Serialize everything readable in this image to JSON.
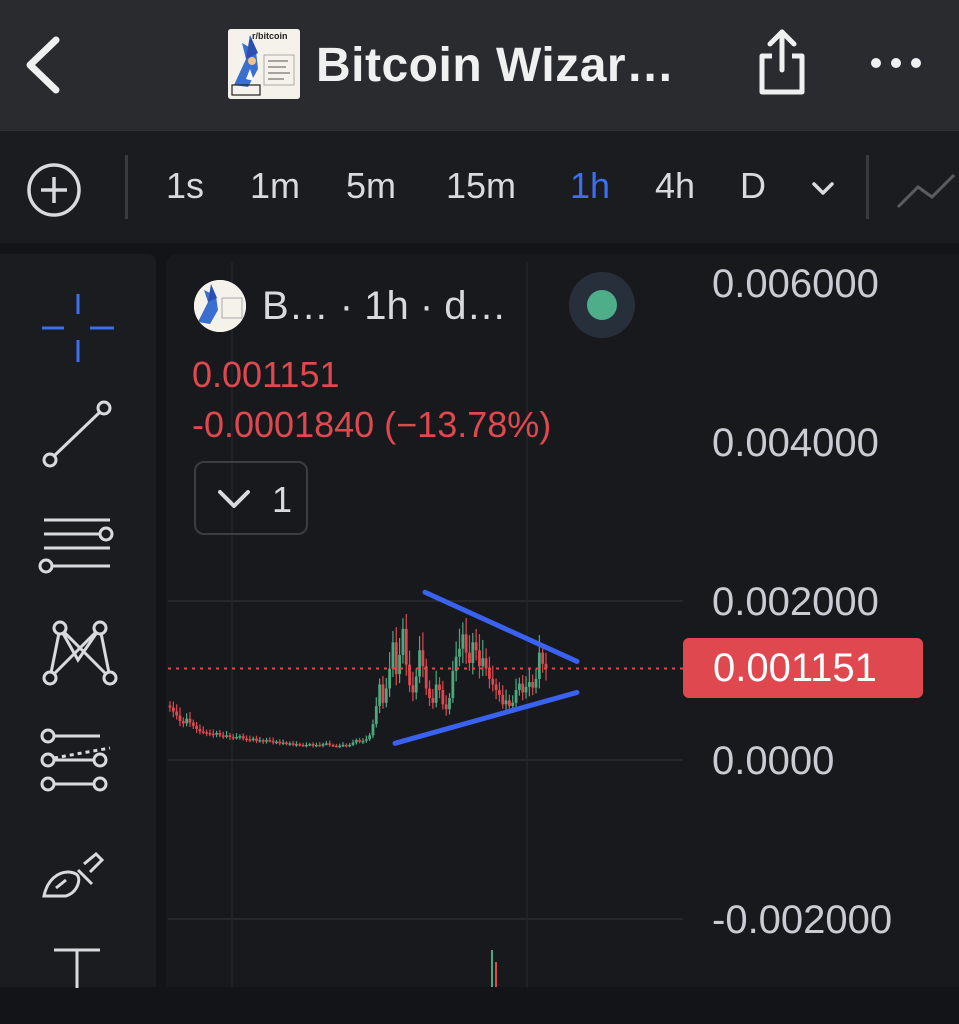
{
  "header": {
    "title": "Bitcoin Wizar…",
    "logo_text": "r/bitcoin",
    "back_icon": "chevron-left-icon",
    "share_icon": "share-icon",
    "more_icon": "ellipsis-icon"
  },
  "toolbar": {
    "add_icon": "plus-circle-icon",
    "timeframes": [
      "1s",
      "1m",
      "5m",
      "15m",
      "1h",
      "4h",
      "D"
    ],
    "active_timeframe": "1h",
    "expand_icon": "chevron-down-icon",
    "chart_type_icon": "line-chart-icon"
  },
  "tools": [
    "crosshair-icon",
    "trendline-icon",
    "fib-retracement-icon",
    "pattern-icon",
    "prediction-icon",
    "brush-icon",
    "text-icon"
  ],
  "legend": {
    "symbol": "B… · 1h · d…",
    "price": "0.001151",
    "change": "-0.0001840 (−13.78%)",
    "indicators_count": "1"
  },
  "colors": {
    "up": "#4ca87f",
    "down": "#e0484f",
    "accent": "#3a6ff0",
    "trendline": "#3a62f0"
  },
  "chart_data": {
    "type": "candlestick",
    "y_axis_ticks": [
      "0.006000",
      "0.004000",
      "0.002000",
      "0.0000",
      "-0.002000"
    ],
    "ylim": [
      -0.002,
      0.006
    ],
    "last_price_label": "0.001151",
    "last_price": 0.001151,
    "trendlines": [
      {
        "from": [
          0,
          0.00211
        ],
        "to": [
          1,
          0.00124
        ]
      },
      {
        "from": [
          0,
          0.00021
        ],
        "to": [
          1,
          0.00085
        ]
      }
    ],
    "close_series": [
      0.00066,
      0.00061,
      0.00056,
      0.00049,
      0.00046,
      0.00052,
      0.00047,
      0.00043,
      0.00039,
      0.00036,
      0.00035,
      0.00034,
      0.00033,
      0.00032,
      0.00034,
      0.00031,
      0.0003,
      0.00031,
      0.00029,
      0.00028,
      0.00029,
      0.0003,
      0.00027,
      0.00026,
      0.00025,
      0.00027,
      0.00024,
      0.00025,
      0.00023,
      0.00025,
      0.00024,
      0.00022,
      0.00023,
      0.00021,
      0.00022,
      0.0002,
      0.00021,
      0.00019,
      0.0002,
      0.00019,
      0.00018,
      0.00019,
      0.0002,
      0.00018,
      0.00019,
      0.00018,
      0.0002,
      0.00021,
      0.00019,
      0.00018,
      0.00017,
      0.00018,
      0.00019,
      0.00018,
      0.00019,
      0.00022,
      0.00025,
      0.00023,
      0.00024,
      0.00026,
      0.00031,
      0.00045,
      0.00068,
      0.00095,
      0.00072,
      0.0009,
      0.00115,
      0.00148,
      0.00108,
      0.00132,
      0.00165,
      0.0012,
      0.00094,
      0.00085,
      0.00105,
      0.00138,
      0.00118,
      0.0009,
      0.00078,
      0.00072,
      0.00095,
      0.00088,
      0.0007,
      0.00064,
      0.00078,
      0.00112,
      0.0013,
      0.0014,
      0.00158,
      0.00135,
      0.00122,
      0.00148,
      0.00138,
      0.00118,
      0.00128,
      0.00115,
      0.00102,
      0.00095,
      0.00088,
      0.00082,
      0.0007,
      0.00075,
      0.00068,
      0.00072,
      0.00088,
      0.00096,
      0.00085,
      0.00092,
      0.00098,
      0.00091,
      0.00102,
      0.00135,
      0.00121,
      0.00115
    ]
  }
}
